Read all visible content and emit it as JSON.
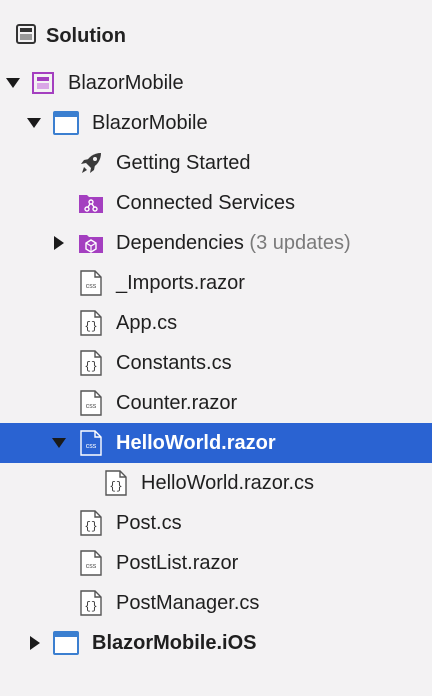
{
  "header": {
    "title": "Solution",
    "icon": "solution-icon"
  },
  "tree": {
    "rows": [
      {
        "label": "BlazorMobile",
        "icon": "solution-project-icon",
        "expanded": true
      },
      {
        "label": "BlazorMobile",
        "icon": "project-window-icon",
        "expanded": true
      },
      {
        "label": "Getting Started",
        "icon": "rocket-icon"
      },
      {
        "label": "Connected Services",
        "icon": "connected-services-folder-icon"
      },
      {
        "label": "Dependencies",
        "extra": " (3 updates)",
        "icon": "dependencies-folder-icon",
        "expanded": false
      },
      {
        "label": "_Imports.razor",
        "icon": "razor-file-icon"
      },
      {
        "label": "App.cs",
        "icon": "cs-file-icon"
      },
      {
        "label": "Constants.cs",
        "icon": "cs-file-icon"
      },
      {
        "label": "Counter.razor",
        "icon": "razor-file-icon"
      },
      {
        "label": "HelloWorld.razor",
        "icon": "razor-file-icon",
        "expanded": true,
        "selected": true
      },
      {
        "label": "HelloWorld.razor.cs",
        "icon": "cs-file-icon"
      },
      {
        "label": "Post.cs",
        "icon": "cs-file-icon"
      },
      {
        "label": "PostList.razor",
        "icon": "razor-file-icon"
      },
      {
        "label": "PostManager.cs",
        "icon": "cs-file-icon"
      },
      {
        "label": "BlazorMobile.iOS",
        "icon": "project-window-icon",
        "expanded": false
      }
    ]
  },
  "colors": {
    "selection": "#2a63d2",
    "purple": "#a43fc0",
    "blue": "#3b7fd0"
  }
}
